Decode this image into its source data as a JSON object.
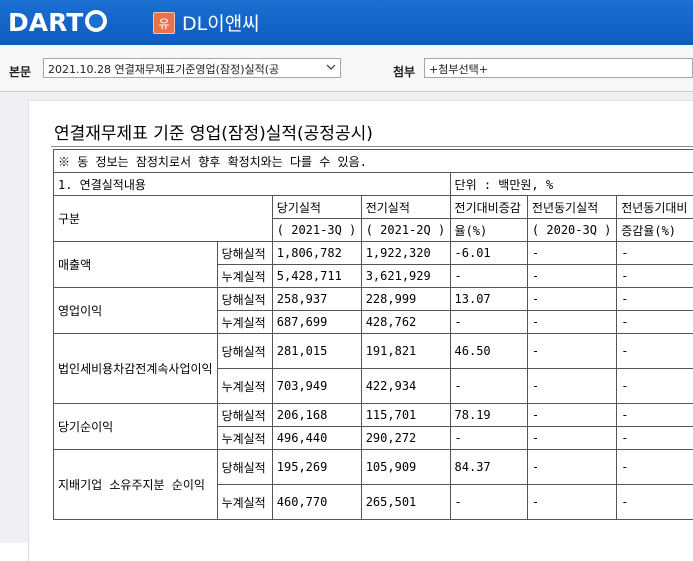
{
  "header": {
    "logo_text": "DART",
    "badge": "유",
    "company": "DL이앤씨"
  },
  "toolbar": {
    "main_label": "본문",
    "main_select": "2021.10.28  연결재무제표기준영업(잠정)실적(공",
    "attach_label": "첨부",
    "attach_select": "+첨부선택+"
  },
  "document": {
    "title": "연결재무제표 기준 영업(잠정)실적(공정공시)",
    "notice": "※ 동 정보는 잠정치로서 향후 확정치와는 다를 수 있음.",
    "section": "1. 연결실적내용",
    "unit": "단위 : 백만원, %",
    "headers": {
      "category": "구분",
      "current": "당기실적",
      "current_period": "( 2021-3Q )",
      "previous": "전기실적",
      "previous_period": "( 2021-2Q )",
      "qoq": "전기대비증감",
      "qoq_unit": "율(%)",
      "yoy_prev": "전년동기실적",
      "yoy_prev_period": "( 2020-3Q )",
      "yoy": "전년동기대비",
      "yoy_unit": "증감율(%)"
    },
    "rows": [
      {
        "item": "매출액",
        "q_label": "당해실적",
        "q_cur": "1,806,782",
        "q_prev": "1,922,320",
        "q_qoq": "-6.01",
        "q_yoyprev": "-",
        "q_yoy": "-",
        "c_label": "누계실적",
        "c_cur": "5,428,711",
        "c_prev": "3,621,929",
        "c_qoq": "-",
        "c_yoyprev": "-",
        "c_yoy": "-"
      },
      {
        "item": "영업이익",
        "q_label": "당해실적",
        "q_cur": "258,937",
        "q_prev": "228,999",
        "q_qoq": "13.07",
        "q_yoyprev": "-",
        "q_yoy": "-",
        "c_label": "누계실적",
        "c_cur": "687,699",
        "c_prev": "428,762",
        "c_qoq": "-",
        "c_yoyprev": "-",
        "c_yoy": "-"
      },
      {
        "item": "법인세비용차감전계속사업이익",
        "q_label": "당해실적",
        "q_cur": "281,015",
        "q_prev": "191,821",
        "q_qoq": "46.50",
        "q_yoyprev": "-",
        "q_yoy": "-",
        "c_label": "누계실적",
        "c_cur": "703,949",
        "c_prev": "422,934",
        "c_qoq": "-",
        "c_yoyprev": "-",
        "c_yoy": "-"
      },
      {
        "item": "당기순이익",
        "q_label": "당해실적",
        "q_cur": "206,168",
        "q_prev": "115,701",
        "q_qoq": "78.19",
        "q_yoyprev": "-",
        "q_yoy": "-",
        "c_label": "누계실적",
        "c_cur": "496,440",
        "c_prev": "290,272",
        "c_qoq": "-",
        "c_yoyprev": "-",
        "c_yoy": "-"
      },
      {
        "item": "지배기업 소유주지분 순이익",
        "q_label": "당해실적",
        "q_cur": "195,269",
        "q_prev": "105,909",
        "q_qoq": "84.37",
        "q_yoyprev": "-",
        "q_yoy": "-",
        "c_label": "누계실적",
        "c_cur": "460,770",
        "c_prev": "265,501",
        "c_qoq": "-",
        "c_yoyprev": "-",
        "c_yoy": "-"
      }
    ]
  },
  "colors": {
    "header_blue": "#1a6fd0",
    "badge_orange": "#e8734a",
    "content_bg": "#eef0f3"
  }
}
